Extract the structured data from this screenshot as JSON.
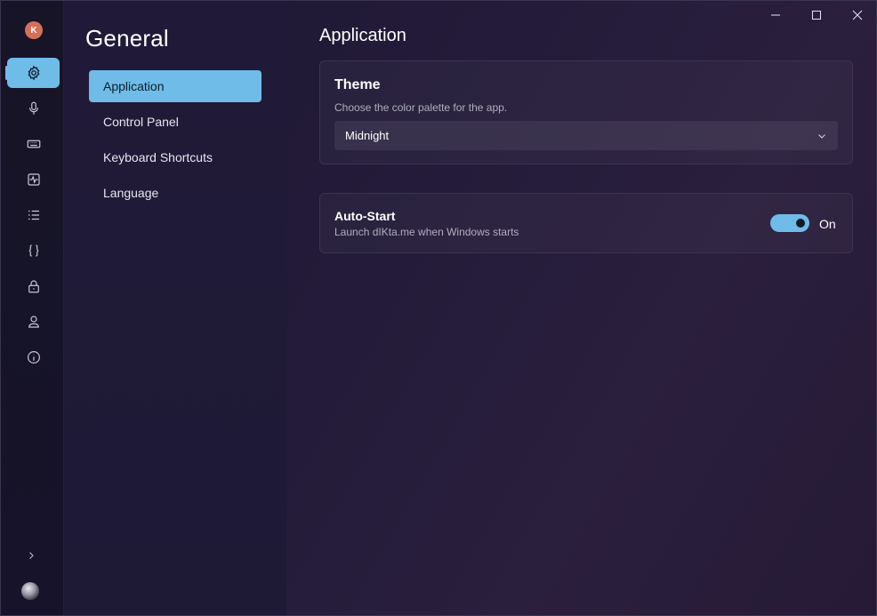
{
  "app": {
    "logo_text": "K"
  },
  "rail": {
    "items": [
      {
        "name": "settings",
        "icon": "gear-icon",
        "active": true
      },
      {
        "name": "microphone",
        "icon": "microphone-icon"
      },
      {
        "name": "keyboard",
        "icon": "keyboard-icon"
      },
      {
        "name": "activity",
        "icon": "activity-icon"
      },
      {
        "name": "list",
        "icon": "list-icon"
      },
      {
        "name": "code",
        "icon": "braces-icon"
      },
      {
        "name": "lock",
        "icon": "lock-icon"
      },
      {
        "name": "user",
        "icon": "user-icon"
      },
      {
        "name": "info",
        "icon": "info-icon"
      }
    ],
    "expand_icon": "chevron-right-icon",
    "avatar": "avatar"
  },
  "subnav": {
    "title": "General",
    "items": [
      {
        "label": "Application",
        "active": true
      },
      {
        "label": "Control Panel"
      },
      {
        "label": "Keyboard Shortcuts"
      },
      {
        "label": "Language"
      }
    ]
  },
  "main": {
    "title": "Application",
    "theme": {
      "title": "Theme",
      "description": "Choose the color palette for the app.",
      "selected": "Midnight"
    },
    "autostart": {
      "title": "Auto-Start",
      "description": "Launch dIKta.me when Windows starts",
      "state_label": "On",
      "enabled": true
    }
  },
  "colors": {
    "accent": "#6fbce8",
    "background": "#1c1830",
    "logo": "#d4705a"
  }
}
